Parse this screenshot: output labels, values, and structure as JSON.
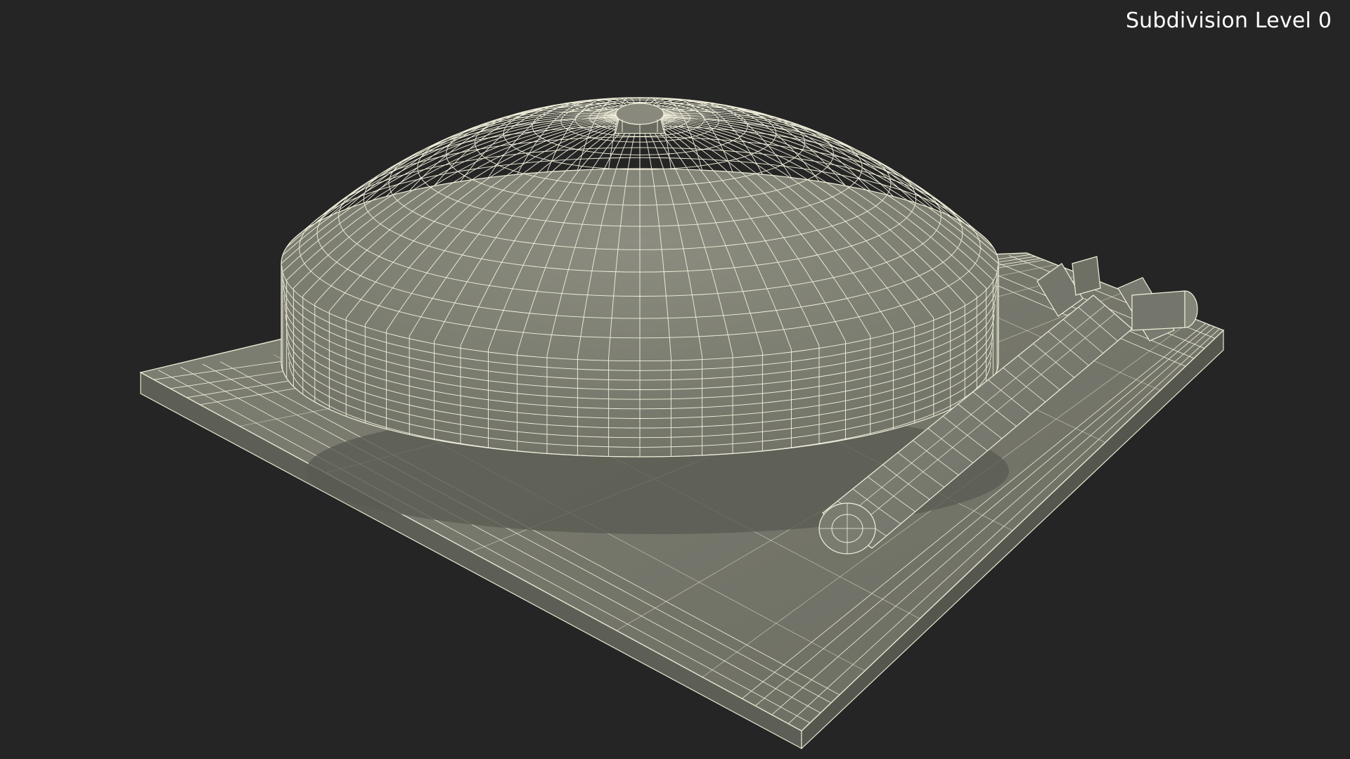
{
  "viewport": {
    "overlay_label": "Subdivision Level 0",
    "background_color": "#252525",
    "surface_color": "#7d7e72",
    "wire_color": "#f2f0dc"
  },
  "model": {
    "objects": [
      "bell-dome",
      "center-nut",
      "base-plate",
      "striker-hammer",
      "hammer-bracket"
    ]
  }
}
